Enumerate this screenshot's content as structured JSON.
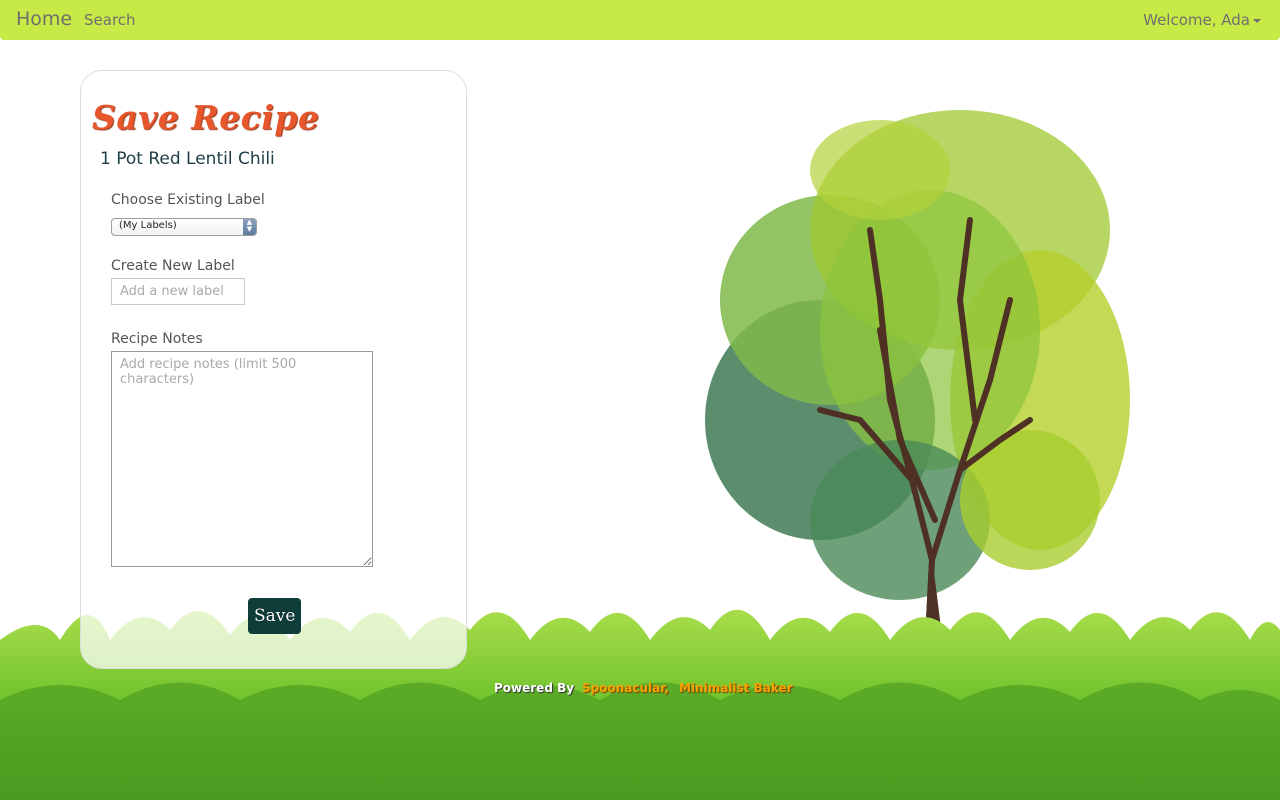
{
  "nav": {
    "home_label": "Home",
    "search_label": "Search",
    "welcome_label": "Welcome, Ada"
  },
  "form": {
    "title": "Save Recipe",
    "recipe_name": "1 Pot Red Lentil Chili",
    "existing_label": {
      "label": "Choose Existing Label",
      "selected": "(My Labels)"
    },
    "new_label": {
      "label": "Create New Label",
      "placeholder": "Add a new label"
    },
    "notes": {
      "label": "Recipe Notes",
      "placeholder": "Add recipe notes (limit 500 characters)"
    },
    "save_label": "Save"
  },
  "footer": {
    "powered_by": "Powered By",
    "sources": [
      "Spoonacular,",
      "Minimalist Baker"
    ]
  },
  "colors": {
    "navbar": "#c7ea46",
    "title": "#e8572b",
    "save_button": "#0e3d3a",
    "source_link": "#f5a300"
  },
  "icons": {
    "select_arrows": "updown-arrows-icon",
    "user_menu": "caret-down-icon"
  }
}
